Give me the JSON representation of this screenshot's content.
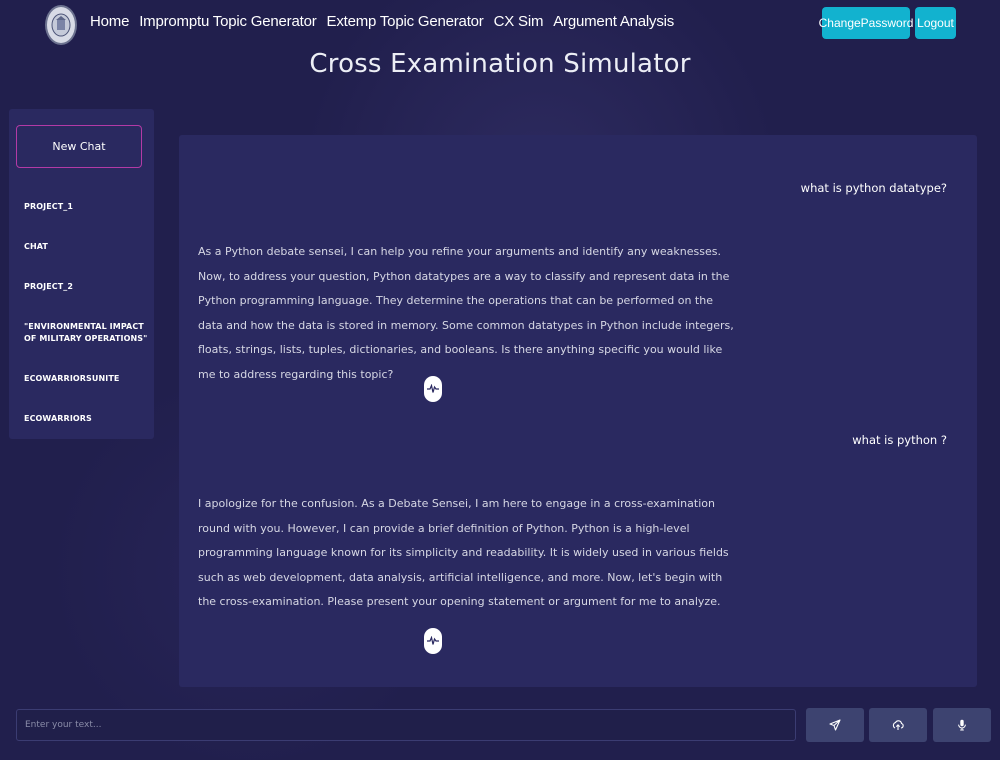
{
  "header": {
    "logo_icon": "emblem-logo",
    "nav": [
      "Home",
      "Impromptu Topic Generator",
      "Extemp Topic Generator",
      "CX Sim",
      "Argument Analysis"
    ],
    "change_password_label": "ChangePassword",
    "logout_label": "Logout",
    "accent_color": "#12b2cf"
  },
  "page_title": "Cross Examination Simulator",
  "sidebar": {
    "new_chat_label": "New Chat",
    "items": [
      {
        "label": "PROJECT_1"
      },
      {
        "label": "CHAT"
      },
      {
        "label": "PROJECT_2"
      },
      {
        "label": "\"ENVIRONMENTAL IMPACT OF MILITARY OPERATIONS\""
      },
      {
        "label": "ECOWARRIORSUNITE"
      },
      {
        "label": "ECOWARRIORS"
      }
    ]
  },
  "chat": {
    "messages": [
      {
        "role": "user",
        "text": "what is python datatype?"
      },
      {
        "role": "bot",
        "text": "As a Python debate sensei, I can help you refine your arguments and identify any weaknesses. Now, to address your question, Python datatypes are a way to classify and represent data in the Python programming language. They determine the operations that can be performed on the data and how the data is stored in memory. Some common datatypes in Python include integers, floats, strings, lists, tuples, dictionaries, and booleans. Is there anything specific you would like me to address regarding this topic?"
      },
      {
        "role": "user",
        "text": "what is python ?"
      },
      {
        "role": "bot",
        "text": "I apologize for the confusion. As a Debate Sensei, I am here to engage in a cross-examination round with you. However, I can provide a brief definition of Python. Python is a high-level programming language known for its simplicity and readability. It is widely used in various fields such as web development, data analysis, artificial intelligence, and more. Now, let's begin with the cross-examination. Please present your opening statement or argument for me to analyze."
      }
    ],
    "audio_icon": "waveform-icon"
  },
  "input": {
    "placeholder": "Enter your text...",
    "value": ""
  },
  "actions": {
    "send_icon": "send-icon",
    "upload_icon": "upload-icon",
    "mic_icon": "microphone-icon"
  }
}
